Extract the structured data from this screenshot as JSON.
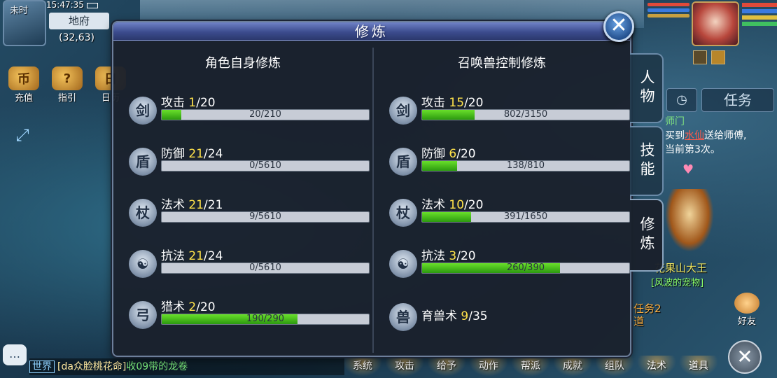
{
  "status": {
    "time_of_day": "未时",
    "clock": "15:47:35",
    "map_name": "地府",
    "coords": "(32,63)"
  },
  "left_menu": [
    {
      "label": "充值",
      "glyph": "币"
    },
    {
      "label": "指引",
      "glyph": "?"
    },
    {
      "label": "日历",
      "glyph": "日"
    }
  ],
  "dialog": {
    "title": "修炼",
    "left_section": "角色自身修炼",
    "right_section": "召唤兽控制修炼",
    "self": [
      {
        "name": "攻击",
        "level": "1",
        "max": "/20",
        "exp": "20/210",
        "fill": 0.095,
        "glyph": "剑"
      },
      {
        "name": "防御",
        "level": "21",
        "max": "/24",
        "exp": "0/5610",
        "fill": 0.0,
        "glyph": "盾"
      },
      {
        "name": "法术",
        "level": "21",
        "max": "/21",
        "exp": "9/5610",
        "fill": 0.0016,
        "glyph": "杖"
      },
      {
        "name": "抗法",
        "level": "21",
        "max": "/24",
        "exp": "0/5610",
        "fill": 0.0,
        "glyph": "☯"
      },
      {
        "name": "猎术",
        "level": "2",
        "max": "/20",
        "exp": "190/290",
        "fill": 0.655,
        "glyph": "弓"
      }
    ],
    "pet": [
      {
        "name": "攻击",
        "level": "15",
        "max": "/20",
        "exp": "802/3150",
        "fill": 0.255,
        "glyph": "剑"
      },
      {
        "name": "防御",
        "level": "6",
        "max": "/20",
        "exp": "138/810",
        "fill": 0.17,
        "glyph": "盾"
      },
      {
        "name": "法术",
        "level": "10",
        "max": "/20",
        "exp": "391/1650",
        "fill": 0.237,
        "glyph": "杖"
      },
      {
        "name": "抗法",
        "level": "3",
        "max": "/20",
        "exp": "260/390",
        "fill": 0.667,
        "glyph": "☯"
      }
    ],
    "pet_extra": {
      "name": "育兽术",
      "level": "9",
      "max": "/35",
      "glyph": "兽"
    }
  },
  "side_tabs": [
    {
      "label": "人物"
    },
    {
      "label": "技能"
    },
    {
      "label": "修炼"
    }
  ],
  "quest_panel": {
    "task_button": "任务",
    "title": "师门",
    "line1_pre": "买到",
    "line1_item": "水仙",
    "line1_post": "送给师傅,",
    "line2": "当前第3次。",
    "npc_name": "花果山大王",
    "npc_sub": "[风波的宠物]",
    "quest2": "任务2\n道"
  },
  "friend_label": "好友",
  "chat": {
    "channel": "世界",
    "speaker": "[da众脸桃花命]",
    "message": "收09带的龙卷"
  },
  "bottom_menu": [
    "系统",
    "攻击",
    "给予",
    "动作",
    "帮派",
    "成就",
    "组队",
    "法术",
    "道具"
  ],
  "colors": {
    "fill_green": "#4fc61e",
    "level_yellow": "#ffe24a",
    "header_blue": "#4a5ca8"
  }
}
